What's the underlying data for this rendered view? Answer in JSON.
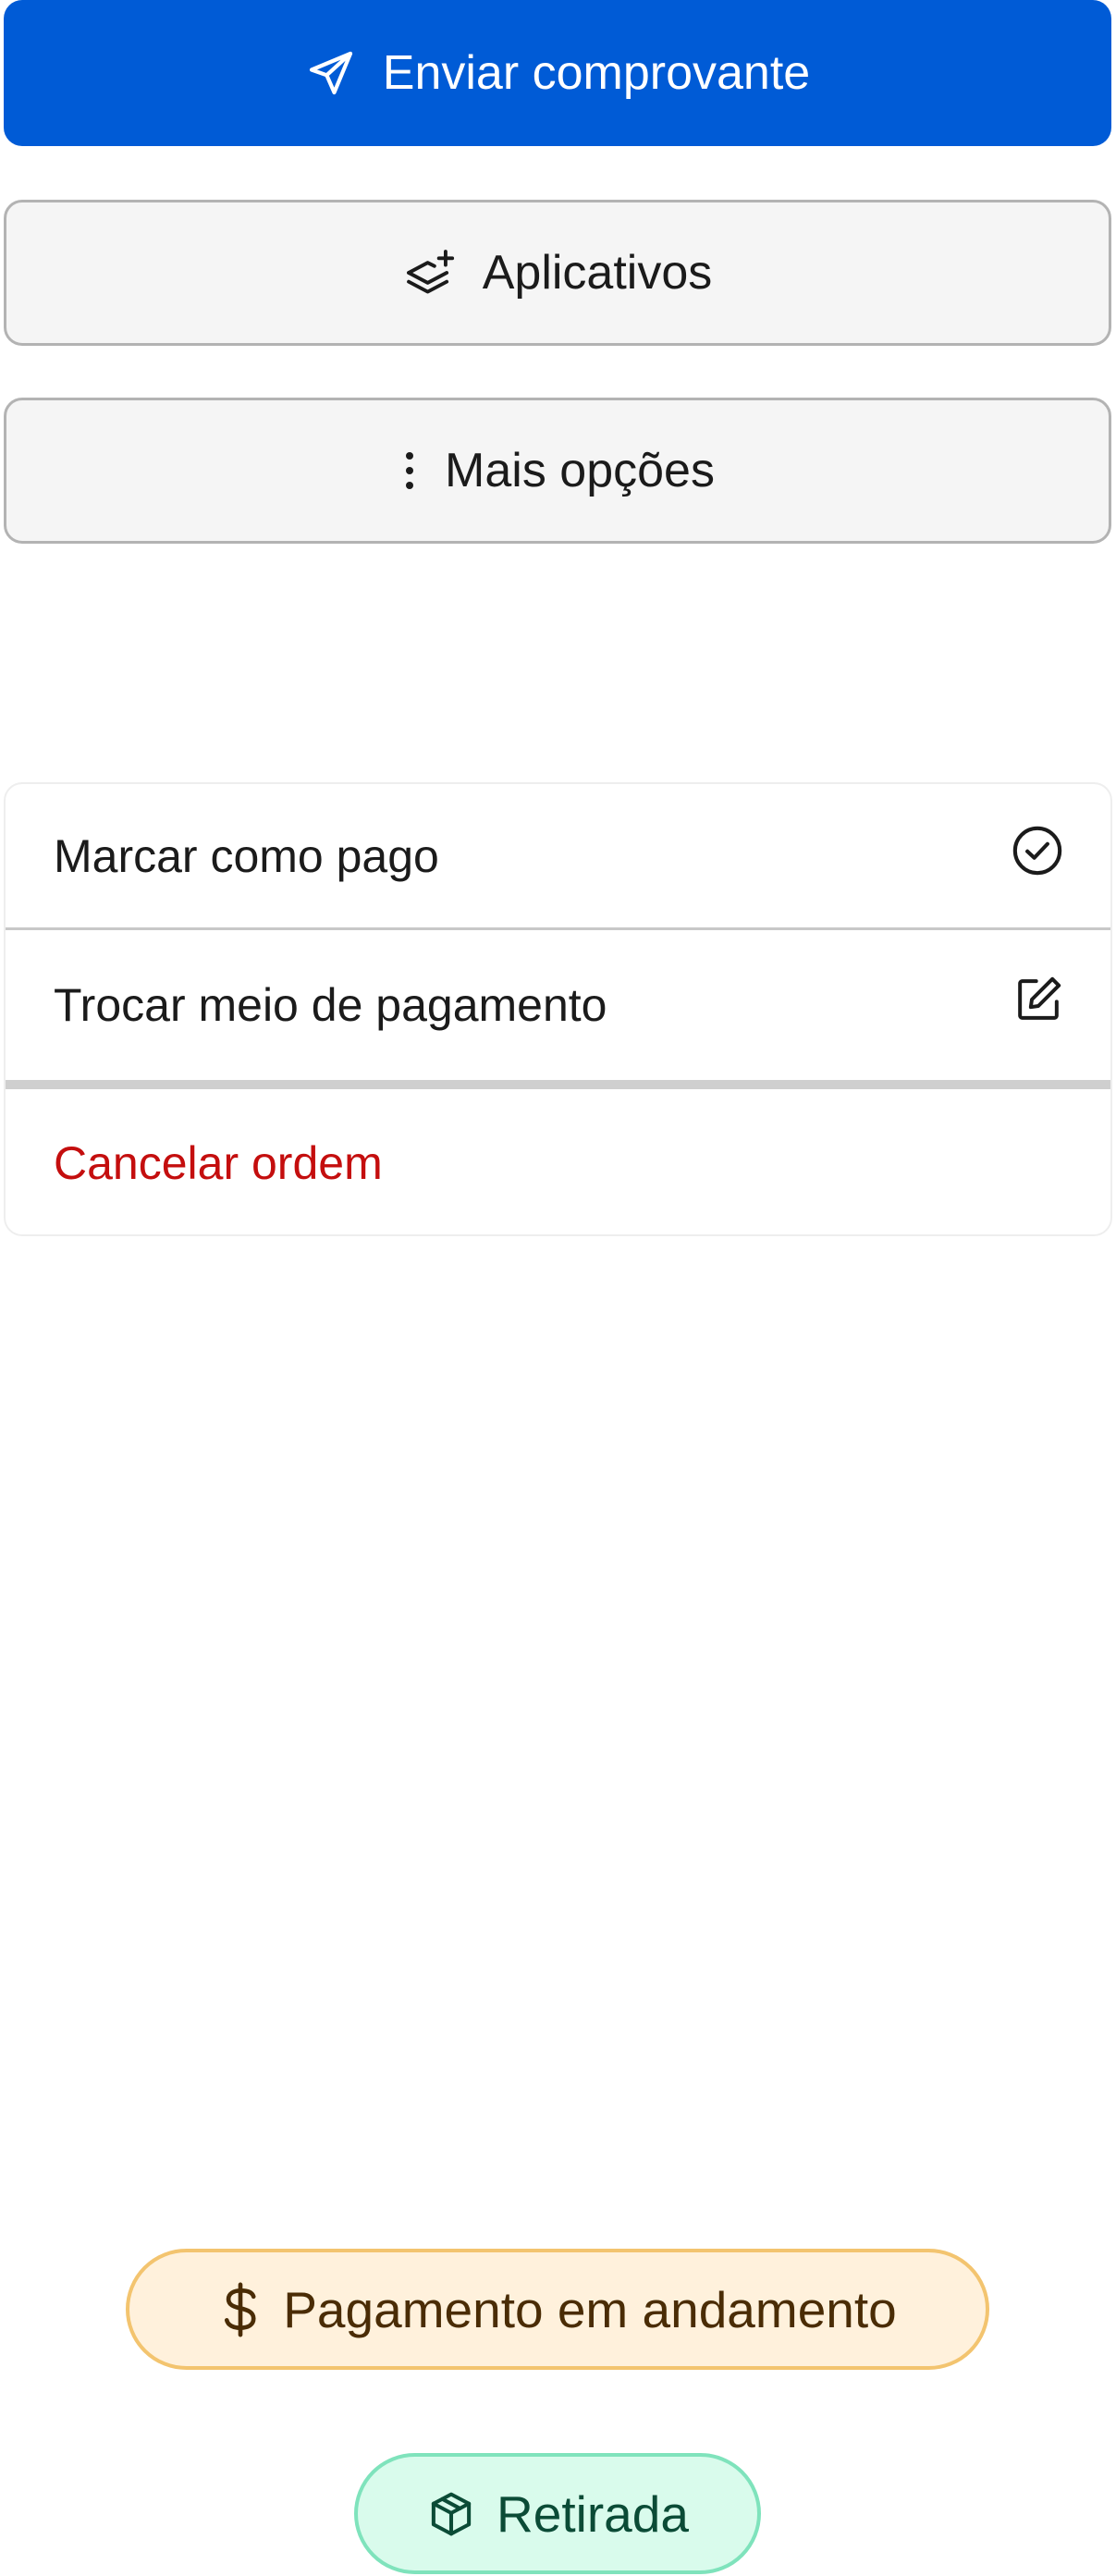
{
  "actions": {
    "send_receipt": {
      "label": "Enviar comprovante",
      "icon": "send-icon"
    },
    "apps": {
      "label": "Aplicativos",
      "icon": "apps-icon"
    },
    "more_options": {
      "label": "Mais opções",
      "icon": "more-vertical-icon"
    }
  },
  "menu": {
    "items": [
      {
        "label": "Marcar como pago",
        "icon": "check-circle-icon"
      },
      {
        "label": "Trocar meio de pagamento",
        "icon": "edit-icon"
      },
      {
        "label": "Cancelar ordem",
        "color": "#c40e0e"
      }
    ]
  },
  "status": {
    "payment": {
      "label": "Pagamento em andamento",
      "icon": "dollar-icon",
      "color": "#f3c46f"
    },
    "delivery": {
      "label": "Retirada",
      "icon": "package-icon",
      "color": "#7fe3bc"
    }
  },
  "colors": {
    "primary": "#005bd6",
    "danger": "#c40e0e"
  }
}
